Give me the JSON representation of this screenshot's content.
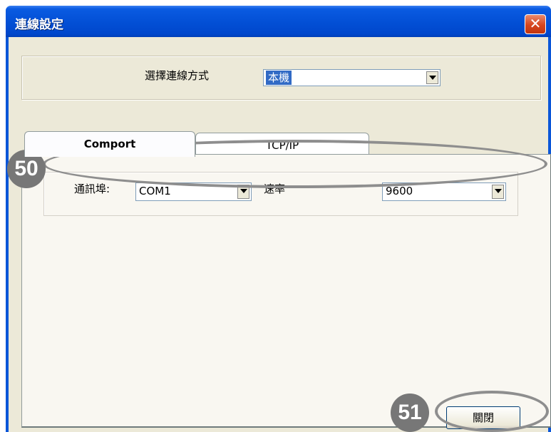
{
  "window": {
    "title": "連線設定",
    "close_glyph": "✕"
  },
  "connection": {
    "label": "選擇連線方式",
    "selected": "本機"
  },
  "tabs": [
    {
      "label": "Comport",
      "active": true
    },
    {
      "label": "TCP/IP",
      "active": false
    }
  ],
  "comport": {
    "port_label": "通訊埠:",
    "port_value": "COM1",
    "rate_label": "速率",
    "rate_value": "9600"
  },
  "annotations": {
    "badge_50": "50",
    "badge_51": "51"
  },
  "buttons": {
    "close_label": "關閉"
  },
  "colors": {
    "titlebar": "#0350d6",
    "face": "#ece9d8",
    "selection": "#316ac5",
    "annotation": "#8e8e8e"
  }
}
